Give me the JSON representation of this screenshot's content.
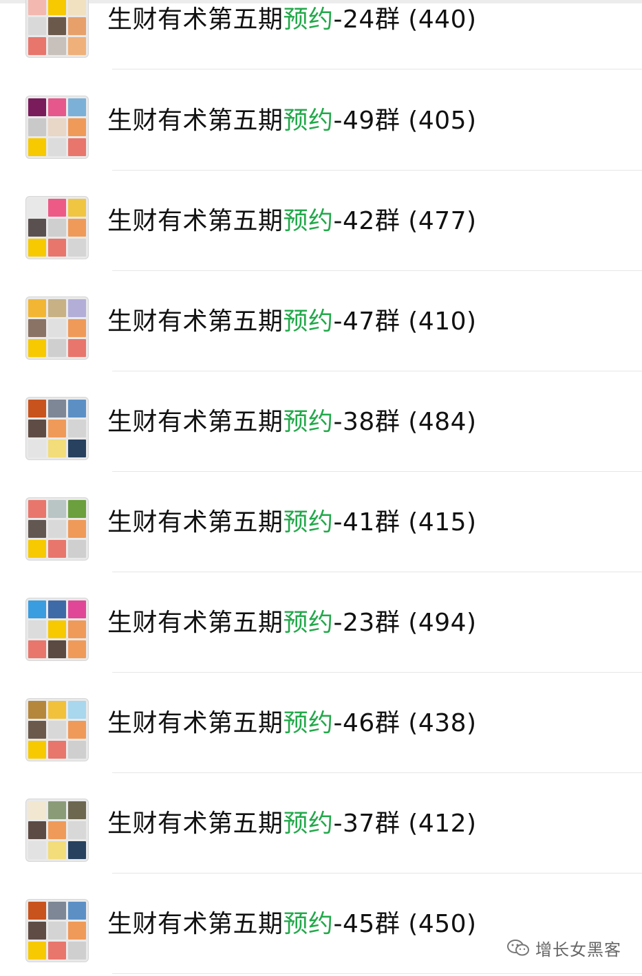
{
  "chat_list": {
    "items": [
      {
        "prefix": "生财有术第五期",
        "highlight": "预约",
        "suffix": "-24群 (440)",
        "avatar": [
          "#f3b8b0",
          "#f7c900",
          "#f2e1c0",
          "#d9d9d9",
          "#6b5a4c",
          "#e7a06a",
          "#e8766c",
          "#c7c0bb",
          "#f0b07a"
        ]
      },
      {
        "prefix": "生财有术第五期",
        "highlight": "预约",
        "suffix": "-49群 (405)",
        "avatar": [
          "#7a1b5b",
          "#e6578c",
          "#7cb0d7",
          "#c9c9c9",
          "#e8d6c6",
          "#ef9a59",
          "#f7c900",
          "#dcdcdc",
          "#e8766c"
        ]
      },
      {
        "prefix": "生财有术第五期",
        "highlight": "预约",
        "suffix": "-42群 (477)",
        "avatar": [
          "#e8e8e8",
          "#ee5a86",
          "#f0c542",
          "#5b5050",
          "#cfcfcf",
          "#ef9a59",
          "#f7c900",
          "#e8766c",
          "#d5d5d5"
        ]
      },
      {
        "prefix": "生财有术第五期",
        "highlight": "预约",
        "suffix": "-47群 (410)",
        "avatar": [
          "#f2b634",
          "#c7b185",
          "#b3aed8",
          "#8a7365",
          "#e0e0e0",
          "#ef9a59",
          "#f7c900",
          "#cfcfcf",
          "#e8766c"
        ]
      },
      {
        "prefix": "生财有术第五期",
        "highlight": "预约",
        "suffix": "-38群 (484)",
        "avatar": [
          "#c8531d",
          "#7d8796",
          "#5c90c5",
          "#5f4d45",
          "#ef9a59",
          "#d4d4d4",
          "#e4e4e4",
          "#f3dc7a",
          "#27415f"
        ]
      },
      {
        "prefix": "生财有术第五期",
        "highlight": "预约",
        "suffix": "-41群 (415)",
        "avatar": [
          "#e8766c",
          "#b8c5c4",
          "#6c9f3d",
          "#635752",
          "#d9d9d9",
          "#ef9a59",
          "#f7c900",
          "#e8766c",
          "#cfcfcf"
        ]
      },
      {
        "prefix": "生财有术第五期",
        "highlight": "预约",
        "suffix": "-23群 (494)",
        "avatar": [
          "#3a9de0",
          "#3f6aa8",
          "#e04897",
          "#dcdcdc",
          "#f7c900",
          "#ef9a59",
          "#e8766c",
          "#5b4a42",
          "#ef9a59"
        ]
      },
      {
        "prefix": "生财有术第五期",
        "highlight": "预约",
        "suffix": "-46群 (438)",
        "avatar": [
          "#b5873d",
          "#f1c13b",
          "#a8d7ee",
          "#6b5a4c",
          "#d8d8d8",
          "#ef9a59",
          "#f7c900",
          "#e8766c",
          "#cfcfcf"
        ]
      },
      {
        "prefix": "生财有术第五期",
        "highlight": "预约",
        "suffix": "-37群 (412)",
        "avatar": [
          "#f2e7d0",
          "#8a9b78",
          "#6d6750",
          "#5c4b44",
          "#ef9a59",
          "#d8d8d8",
          "#e2e2e2",
          "#f3dc7a",
          "#27415f"
        ]
      },
      {
        "prefix": "生财有术第五期",
        "highlight": "预约",
        "suffix": "-45群 (450)",
        "avatar": [
          "#c8531d",
          "#7d8796",
          "#5c90c5",
          "#5f4d45",
          "#d4d4d4",
          "#ef9a59",
          "#f7c900",
          "#e8766c",
          "#cfcfcf"
        ]
      }
    ]
  },
  "watermark": {
    "text": "增长女黑客",
    "icon": "wechat-official-account-icon"
  },
  "colors": {
    "highlight": "#22a84a",
    "text": "#111111",
    "divider": "#e6e6e6"
  }
}
